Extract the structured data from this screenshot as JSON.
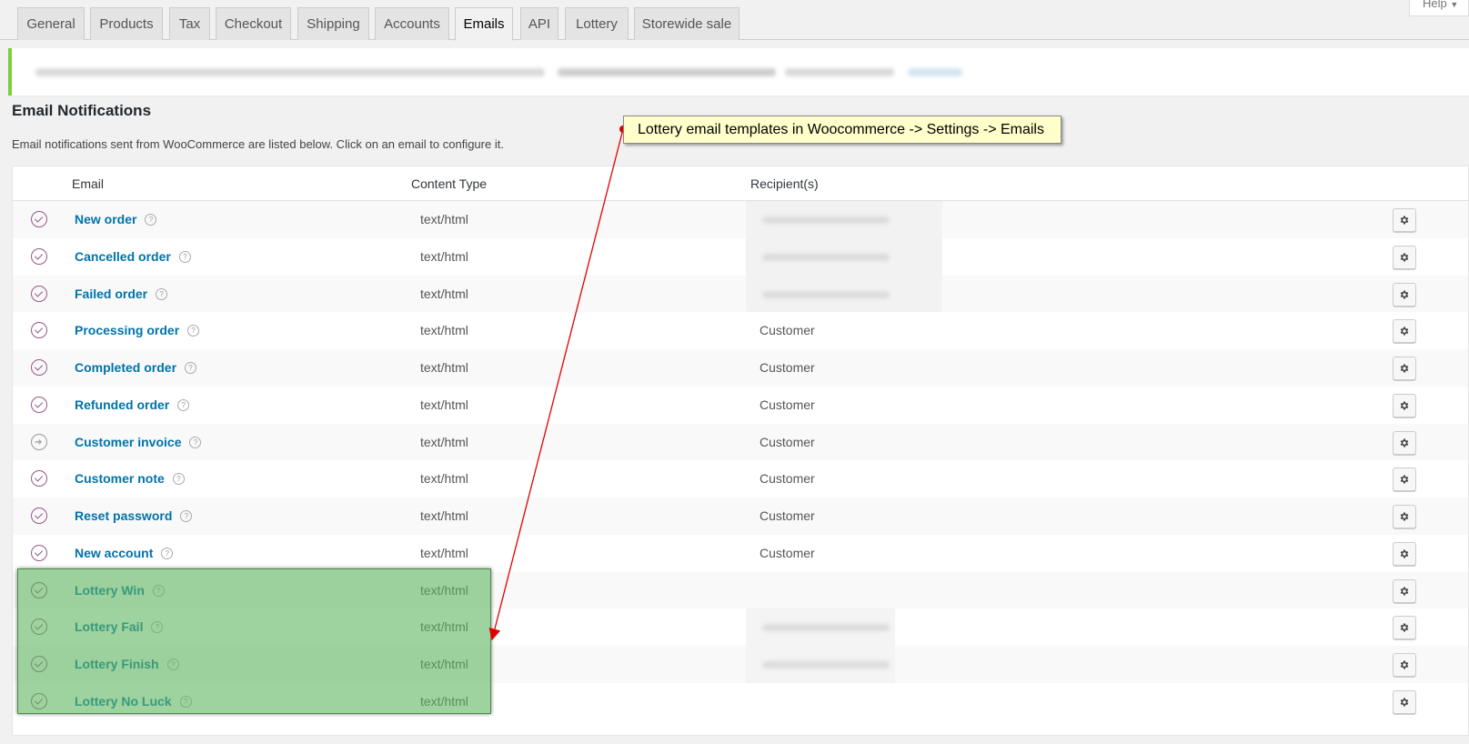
{
  "tabs": [
    {
      "label": "General"
    },
    {
      "label": "Products"
    },
    {
      "label": "Tax"
    },
    {
      "label": "Checkout"
    },
    {
      "label": "Shipping"
    },
    {
      "label": "Accounts"
    },
    {
      "label": "Emails",
      "active": true
    },
    {
      "label": "API"
    },
    {
      "label": "Lottery"
    },
    {
      "label": "Storewide sale"
    }
  ],
  "help_label": "Help",
  "section": {
    "title": "Email Notifications",
    "description": "Email notifications sent from WooCommerce are listed below. Click on an email to configure it."
  },
  "table": {
    "headers": {
      "email": "Email",
      "content_type": "Content Type",
      "recipients": "Recipient(s)"
    },
    "rows": [
      {
        "name": "New order",
        "content_type": "text/html",
        "recipient": "",
        "status": "enabled"
      },
      {
        "name": "Cancelled order",
        "content_type": "text/html",
        "recipient": "",
        "status": "enabled"
      },
      {
        "name": "Failed order",
        "content_type": "text/html",
        "recipient": "",
        "status": "enabled"
      },
      {
        "name": "Processing order",
        "content_type": "text/html",
        "recipient": "Customer",
        "status": "enabled"
      },
      {
        "name": "Completed order",
        "content_type": "text/html",
        "recipient": "Customer",
        "status": "enabled"
      },
      {
        "name": "Refunded order",
        "content_type": "text/html",
        "recipient": "Customer",
        "status": "enabled"
      },
      {
        "name": "Customer invoice",
        "content_type": "text/html",
        "recipient": "Customer",
        "status": "manual"
      },
      {
        "name": "Customer note",
        "content_type": "text/html",
        "recipient": "Customer",
        "status": "enabled"
      },
      {
        "name": "Reset password",
        "content_type": "text/html",
        "recipient": "Customer",
        "status": "enabled"
      },
      {
        "name": "New account",
        "content_type": "text/html",
        "recipient": "Customer",
        "status": "enabled"
      },
      {
        "name": "Lottery Win",
        "content_type": "text/html",
        "recipient": "",
        "status": "enabled"
      },
      {
        "name": "Lottery Fail",
        "content_type": "text/html",
        "recipient": "",
        "status": "enabled"
      },
      {
        "name": "Lottery Finish",
        "content_type": "text/html",
        "recipient": "",
        "status": "enabled"
      },
      {
        "name": "Lottery No Luck",
        "content_type": "text/html",
        "recipient": "",
        "status": "enabled"
      }
    ]
  },
  "annotation": {
    "text": "Lottery email templates in Woocommerce -> Settings -> Emails"
  },
  "colors": {
    "link": "#0073aa",
    "status": "#96588a",
    "highlight": "#5eb45e",
    "callout_bg": "#ffffcc",
    "arrow": "#e00000"
  }
}
